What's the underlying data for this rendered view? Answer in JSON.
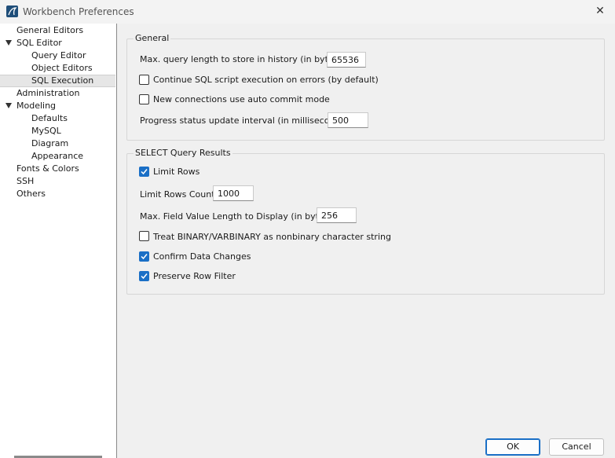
{
  "window": {
    "title": "Workbench Preferences"
  },
  "sidebar": {
    "items": [
      {
        "label": "General Editors"
      },
      {
        "label": "SQL Editor"
      },
      {
        "label": "Query Editor"
      },
      {
        "label": "Object Editors"
      },
      {
        "label": "SQL Execution"
      },
      {
        "label": "Administration"
      },
      {
        "label": "Modeling"
      },
      {
        "label": "Defaults"
      },
      {
        "label": "MySQL"
      },
      {
        "label": "Diagram"
      },
      {
        "label": "Appearance"
      },
      {
        "label": "Fonts & Colors"
      },
      {
        "label": "SSH"
      },
      {
        "label": "Others"
      }
    ],
    "selected": "SQL Execution"
  },
  "general": {
    "title": "General",
    "max_query_label": "Max. query length to store in history (in bytes):",
    "max_query_value": "65536",
    "continue_label": "Continue SQL script execution on errors (by default)",
    "continue_checked": false,
    "autocommit_label": "New connections use auto commit mode",
    "autocommit_checked": false,
    "progress_label": "Progress status update interval (in milliseconds):",
    "progress_value": "500"
  },
  "select_results": {
    "title": "SELECT Query Results",
    "limit_rows_label": "Limit Rows",
    "limit_rows_checked": true,
    "limit_count_label": "Limit Rows Count:",
    "limit_count_value": "1000",
    "max_field_label": "Max. Field Value Length to Display (in bytes):",
    "max_field_value": "256",
    "binary_label": "Treat BINARY/VARBINARY as nonbinary character string",
    "binary_checked": false,
    "confirm_label": "Confirm Data Changes",
    "confirm_checked": true,
    "preserve_label": "Preserve Row Filter",
    "preserve_checked": true
  },
  "buttons": {
    "ok": "OK",
    "cancel": "Cancel"
  },
  "icons": {
    "app": "workbench-dolphin-icon",
    "close": "close-icon",
    "check": "checkmark-icon"
  },
  "colors": {
    "accent": "#1a6fc6"
  }
}
